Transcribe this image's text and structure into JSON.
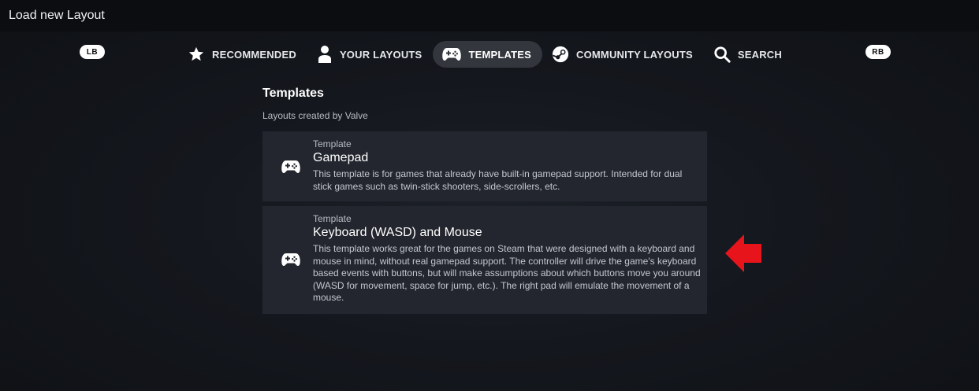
{
  "window": {
    "title": "Load new Layout"
  },
  "bumpers": {
    "left": "LB",
    "right": "RB"
  },
  "tabs": [
    {
      "label": "RECOMMENDED",
      "icon": "star-icon",
      "active": false
    },
    {
      "label": "YOUR LAYOUTS",
      "icon": "person-icon",
      "active": false
    },
    {
      "label": "TEMPLATES",
      "icon": "gamepad-icon",
      "active": true
    },
    {
      "label": "COMMUNITY LAYOUTS",
      "icon": "steam-icon",
      "active": false
    },
    {
      "label": "SEARCH",
      "icon": "search-icon",
      "active": false
    }
  ],
  "section": {
    "title": "Templates",
    "subtitle": "Layouts created by Valve"
  },
  "templates": [
    {
      "kind": "Template",
      "name": "Gamepad",
      "icon": "gamepad-icon",
      "description": "This template is for games that already have built-in gamepad support. Intended for dual stick games such as twin-stick shooters, side-scrollers, etc."
    },
    {
      "kind": "Template",
      "name": "Keyboard (WASD) and Mouse",
      "icon": "gamepad-icon",
      "description": "This template works great for the games on Steam that were designed with a keyboard and mouse in mind, without real gamepad support. The controller will drive the game's keyboard based events with buttons, but will make assumptions about which buttons move you around (WASD for movement, space for jump, etc.). The right pad will emulate the movement of a mouse."
    }
  ],
  "annotation": {
    "icon": "red-arrow-left-icon",
    "color": "#e8141c"
  },
  "colors": {
    "active_tab": "#33363d",
    "card_bg": "#23262e",
    "titlebar_bg": "#0c0d10"
  }
}
